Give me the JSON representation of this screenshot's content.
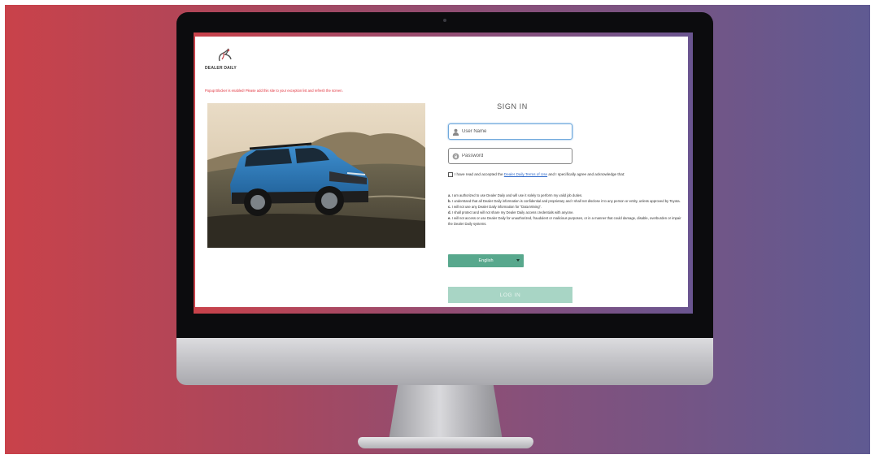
{
  "brand": {
    "name": "DEALER DAILY"
  },
  "popup_warning": "Popup Blocker is enabled! Please add this site to your exception list and refresh the screen.",
  "signin": {
    "title": "SIGN IN",
    "username_placeholder": "User Name",
    "password_placeholder": "Password"
  },
  "terms": {
    "prefix": "I have read and accepted the ",
    "link": "Dealer Daily Terms of Use",
    "suffix": " and I specifically agree and acknowledge that:",
    "clauses": [
      {
        "letter": "a.",
        "text": "I am authorized to use Dealer Daily and will use it solely to perform my valid job duties."
      },
      {
        "letter": "b.",
        "text": "I understand that all Dealer Daily information is confidential and proprietary and I shall not disclose it to any person or entity, unless approved by Toyota."
      },
      {
        "letter": "c.",
        "text": "I will not use any Dealer Daily information for \"Data Mining\"."
      },
      {
        "letter": "d.",
        "text": "I shall protect and will not share my Dealer Daily access credentials with anyone."
      },
      {
        "letter": "e.",
        "text": "I will not access or use Dealer Daily for unauthorized, fraudulent or malicious purposes, or in a manner that could damage, disable, overburden or impair the Dealer Daily systems."
      }
    ]
  },
  "language": {
    "selected": "English"
  },
  "login_label": "LOG IN",
  "colors": {
    "accent_green": "#58a88d",
    "login_disabled": "#a8d5c5",
    "warning_red": "#e0303a",
    "link_blue": "#2a66c9",
    "car_blue": "#2f79b8"
  },
  "icons": {
    "username": "user-icon",
    "password": "lock-icon",
    "logo": "dealer-daily-logo-icon"
  }
}
